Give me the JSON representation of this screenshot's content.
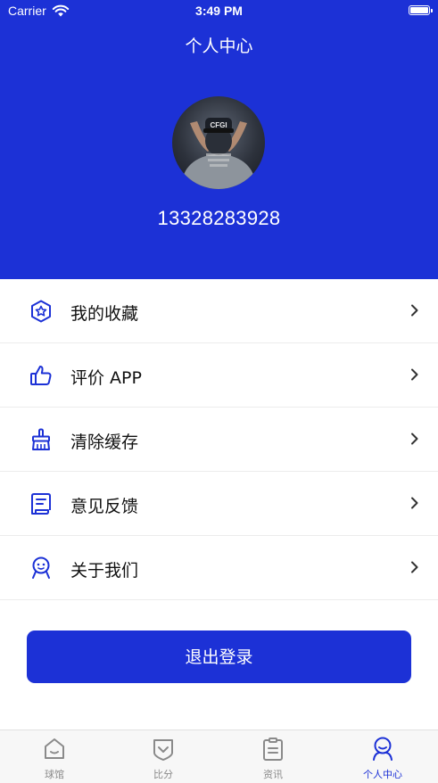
{
  "status_bar": {
    "carrier": "Carrier",
    "time": "3:49 PM"
  },
  "header": {
    "title": "个人中心",
    "phone": "13328283928"
  },
  "menu": {
    "items": [
      {
        "label": "我的收藏",
        "icon": "star-badge-icon"
      },
      {
        "label": "评价 APP",
        "icon": "thumbs-up-icon"
      },
      {
        "label": "清除缓存",
        "icon": "brush-icon"
      },
      {
        "label": "意见反馈",
        "icon": "feedback-document-icon"
      },
      {
        "label": "关于我们",
        "icon": "smiley-user-icon"
      }
    ]
  },
  "logout": {
    "label": "退出登录"
  },
  "tabbar": {
    "tabs": [
      {
        "label": "球馆",
        "icon": "home-icon"
      },
      {
        "label": "比分",
        "icon": "score-shield-icon"
      },
      {
        "label": "资讯",
        "icon": "clipboard-icon"
      },
      {
        "label": "个人中心",
        "icon": "profile-icon",
        "active": true
      }
    ]
  },
  "colors": {
    "primary": "#1c31d6",
    "tab_inactive": "#8a8a8a"
  }
}
